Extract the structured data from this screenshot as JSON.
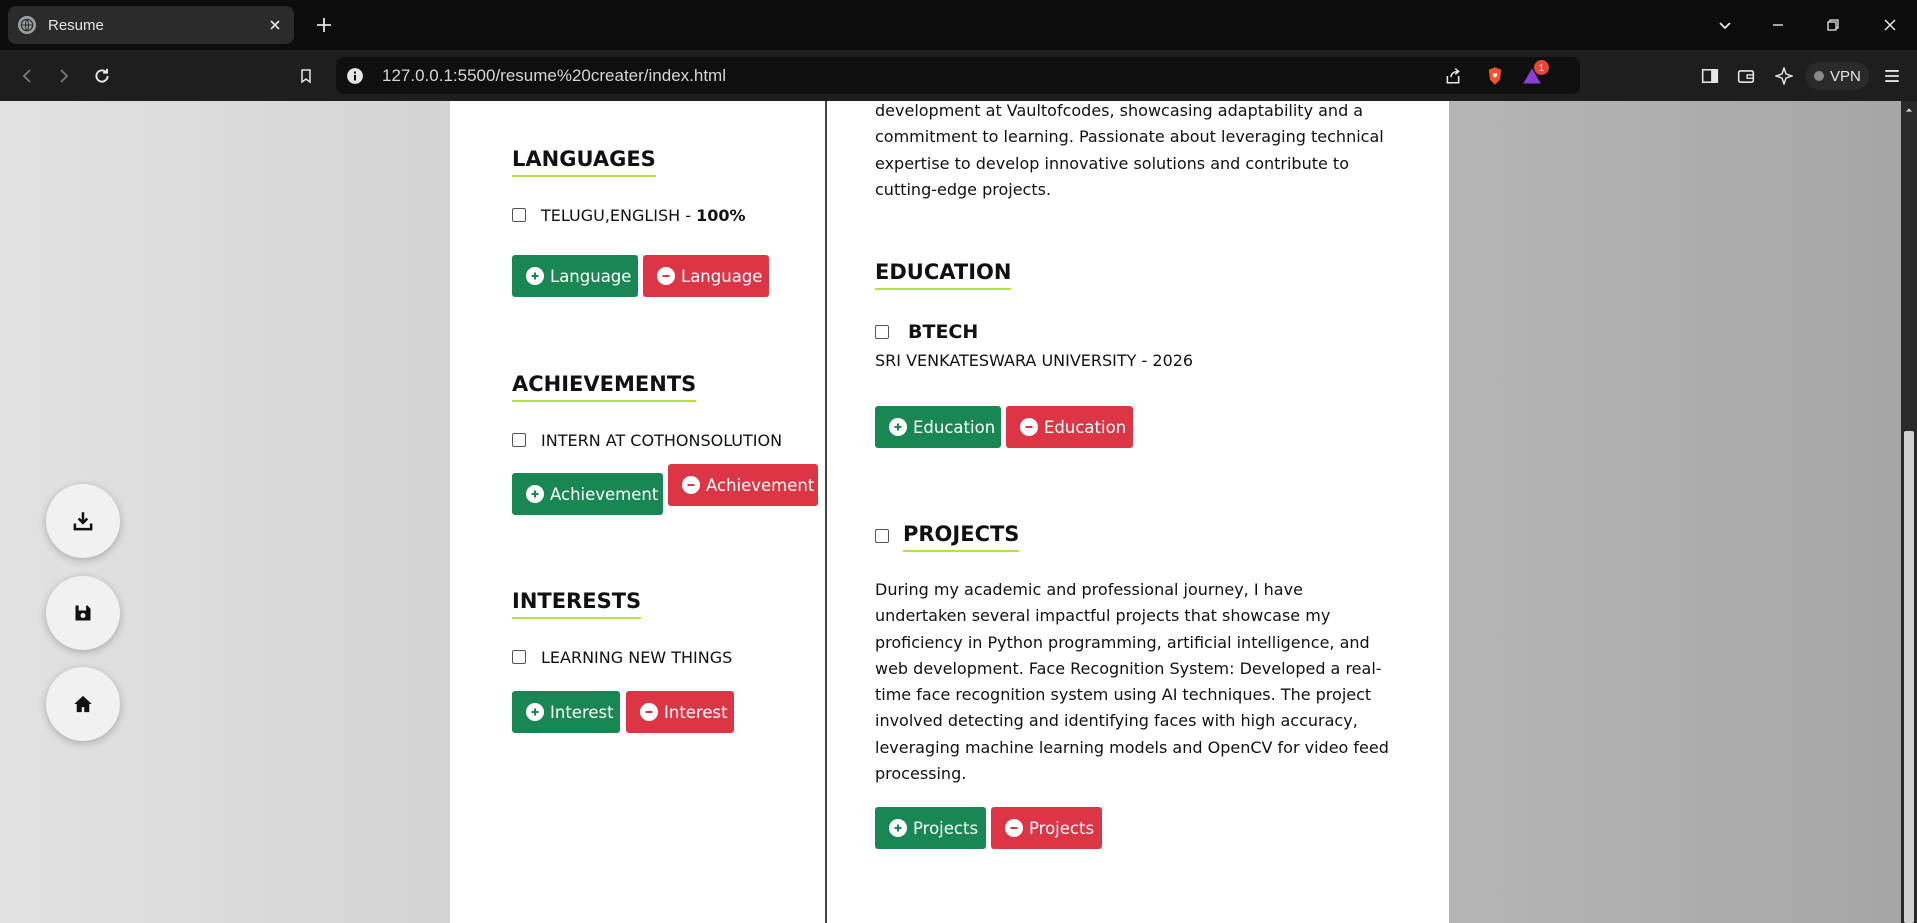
{
  "browser": {
    "tab_title": "Resume",
    "url": "127.0.0.1:5500/resume%20creater/index.html",
    "vpn_label": "VPN",
    "notification_count": "1"
  },
  "fabs": [
    "download-icon",
    "save-icon",
    "home-icon"
  ],
  "resume": {
    "languages": {
      "title": "LANGUAGES",
      "item_text": "TELUGU,ENGLISH - ",
      "item_level": "100%",
      "add_label": "Language",
      "remove_label": "Language"
    },
    "achievements": {
      "title": "ACHIEVEMENTS",
      "item": "INTERN AT COTHONSOLUTION",
      "add_label": "Achievement",
      "remove_label": "Achievement"
    },
    "interests": {
      "title": "INTERESTS",
      "item": "LEARNING NEW THINGS",
      "add_label": "Interest",
      "remove_label": "Interest"
    },
    "summary": {
      "lines": [
        "development at Vaultofcodes, showcasing adaptability and a",
        "commitment to learning. Passionate about leveraging technical",
        "expertise to develop innovative solutions and contribute to",
        "cutting-edge projects."
      ]
    },
    "education": {
      "title": "EDUCATION",
      "degree": "BTECH",
      "institution": "SRI VENKATESWARA UNIVERSITY - 2026",
      "add_label": "Education",
      "remove_label": "Education"
    },
    "projects": {
      "title": "PROJECTS",
      "lines": [
        "During my academic and professional journey, I have",
        "undertaken several impactful projects that showcase my",
        "proficiency in Python programming, artificial intelligence, and",
        "web development. Face Recognition System: Developed a real-",
        "time face recognition system using AI techniques. The project",
        "involved detecting and identifying faces with high accuracy,",
        "leveraging machine learning models and OpenCV for video feed",
        "processing."
      ],
      "add_label": "Projects",
      "remove_label": "Projects"
    }
  },
  "colors": {
    "add": "#198754",
    "remove": "#dc3545",
    "underline": "#b4e33d"
  }
}
